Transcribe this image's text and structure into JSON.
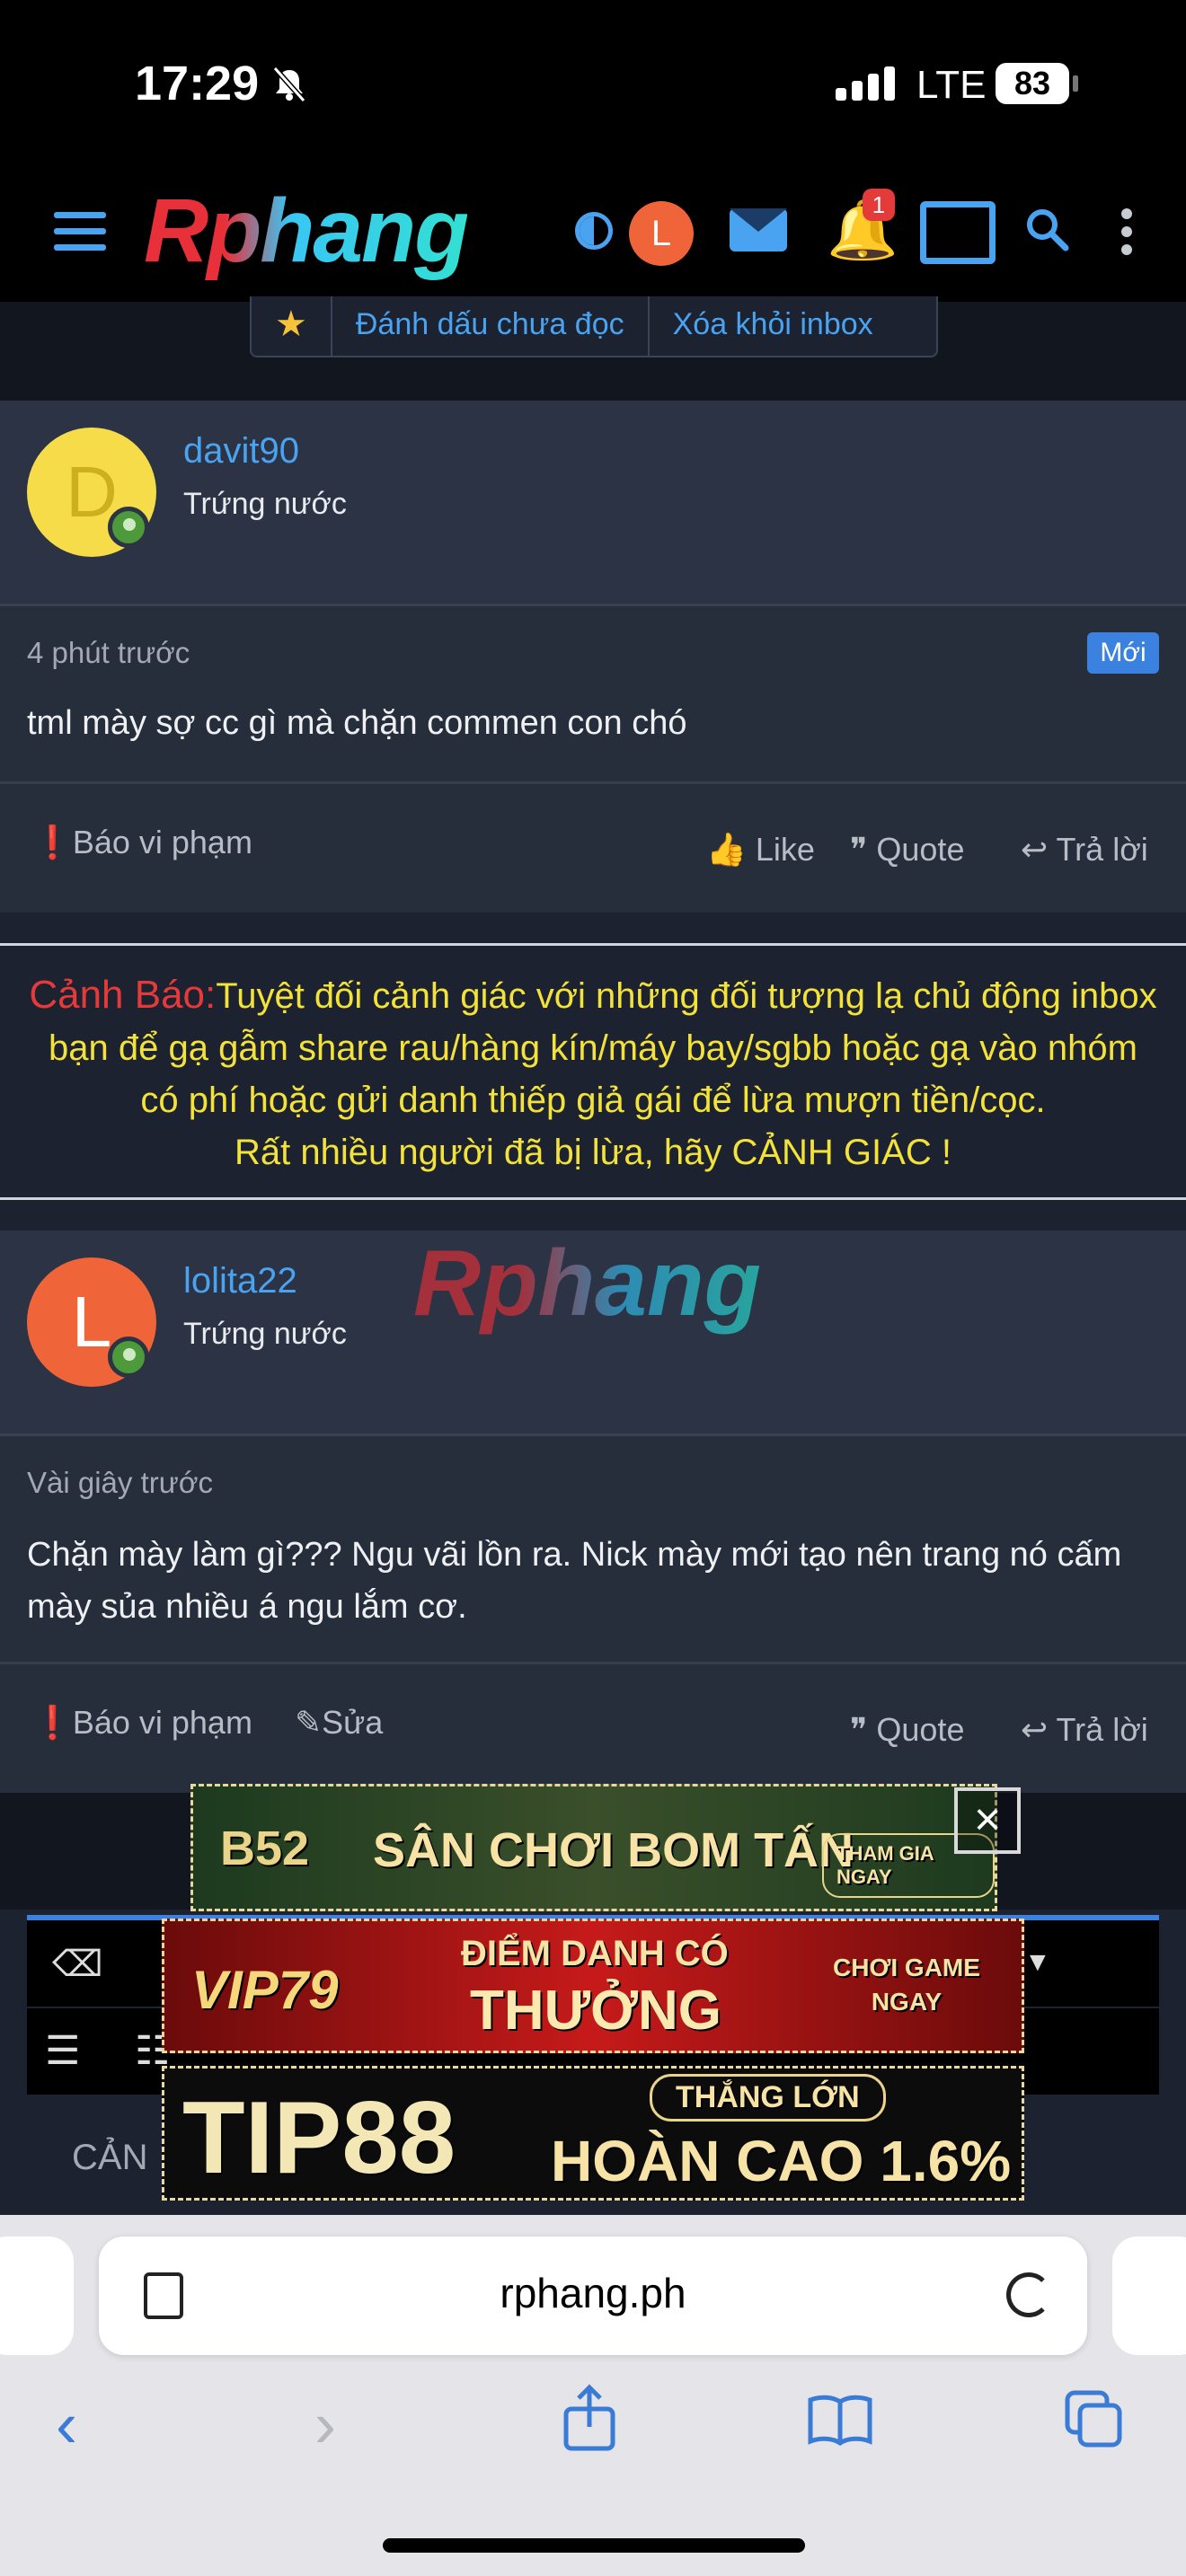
{
  "status_bar": {
    "time": "17:29",
    "network": "LTE",
    "battery": "83"
  },
  "header": {
    "logo": "Rphang",
    "avatar_letter": "L",
    "notification_count": "1"
  },
  "action_bar": {
    "mark_unread": "Đánh dấu chưa đọc",
    "remove_inbox": "Xóa khỏi inbox"
  },
  "posts": [
    {
      "avatar_letter": "D",
      "avatar_color": "#f7dc4a",
      "username": "davit90",
      "user_title": "Trứng nước",
      "time": "4 phút trước",
      "badge": "Mới",
      "body": "tml mày sợ cc gì mà chặn commen con chó",
      "report": "Báo vi phạm",
      "like": "Like",
      "quote": "Quote",
      "reply": "Trả lời"
    },
    {
      "avatar_letter": "L",
      "avatar_color": "#f0643a",
      "username": "lolita22",
      "user_title": "Trứng nước",
      "time": "Vài giây trước",
      "body": "Chặn mày làm gì??? Ngu vãi lồn ra. Nick mày mới tạo nên trang nó cấm mày sủa nhiều á ngu lắm cơ.",
      "report": "Báo vi phạm",
      "edit": "Sửa",
      "quote": "Quote",
      "reply": "Trả lời"
    }
  ],
  "warning": {
    "label": "Cảnh Báo:",
    "line1": "Tuyệt đối cảnh giác với những đối tượng lạ chủ động inbox",
    "line2": "bạn để gạ gẫm share rau/hàng kín/máy bay/sgbb hoặc gạ vào nhóm",
    "line3": "có phí hoặc gửi danh thiếp giả gái để lừa mượn tiền/cọc.",
    "line4": "Rất nhiều người đã bị lừa, hãy CẢNH GIÁC !"
  },
  "watermark": "Rphang",
  "editor": {
    "text_partial": "CẢN"
  },
  "ads": {
    "b52": {
      "brand": "B52",
      "headline": "SÂN CHƠI BOM TẤN",
      "cta": "THAM GIA NGAY"
    },
    "vip79": {
      "brand": "VIP79",
      "headline1": "ĐIỂM DANH CÓ",
      "headline2": "THƯỞNG",
      "cta1": "CHƠI GAME",
      "cta2": "NGAY"
    },
    "tip88": {
      "brand": "TIP88",
      "tag": "THẮNG LỚN",
      "headline": "HOÀN CAO 1.6%"
    },
    "close": "×"
  },
  "browser": {
    "url": "rphang.ph"
  },
  "colors": {
    "accent": "#4aa3f0",
    "warning_text": "#f3e23a",
    "warning_label": "#e53a3a",
    "new_badge": "#3b82e0"
  }
}
